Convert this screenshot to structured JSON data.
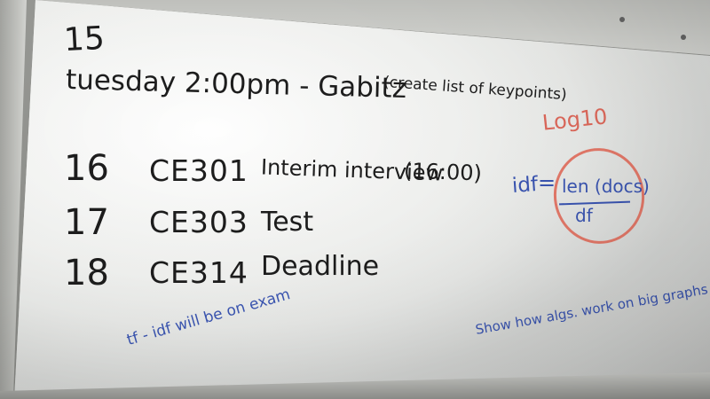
{
  "board": {
    "number": "15",
    "tuesday_line": "tuesday 2:00pm - Gabitz",
    "tuesday_note": "(create list of keypoints)",
    "log_label": "Log10",
    "entries": [
      {
        "day": "16",
        "course": "CE301",
        "description": "Interim interview",
        "time": "(16:00)"
      },
      {
        "day": "17",
        "course": "CE303",
        "description": "Test"
      },
      {
        "day": "18",
        "course": "CE314",
        "description": "Deadline"
      }
    ],
    "formula": {
      "left_side": "idf",
      "equals": "=",
      "numerator": "len (docs)",
      "denominator": "df"
    },
    "exam_note": "tf - idf will be on exam",
    "graph_note": "Show how algs. work on big graphs"
  }
}
